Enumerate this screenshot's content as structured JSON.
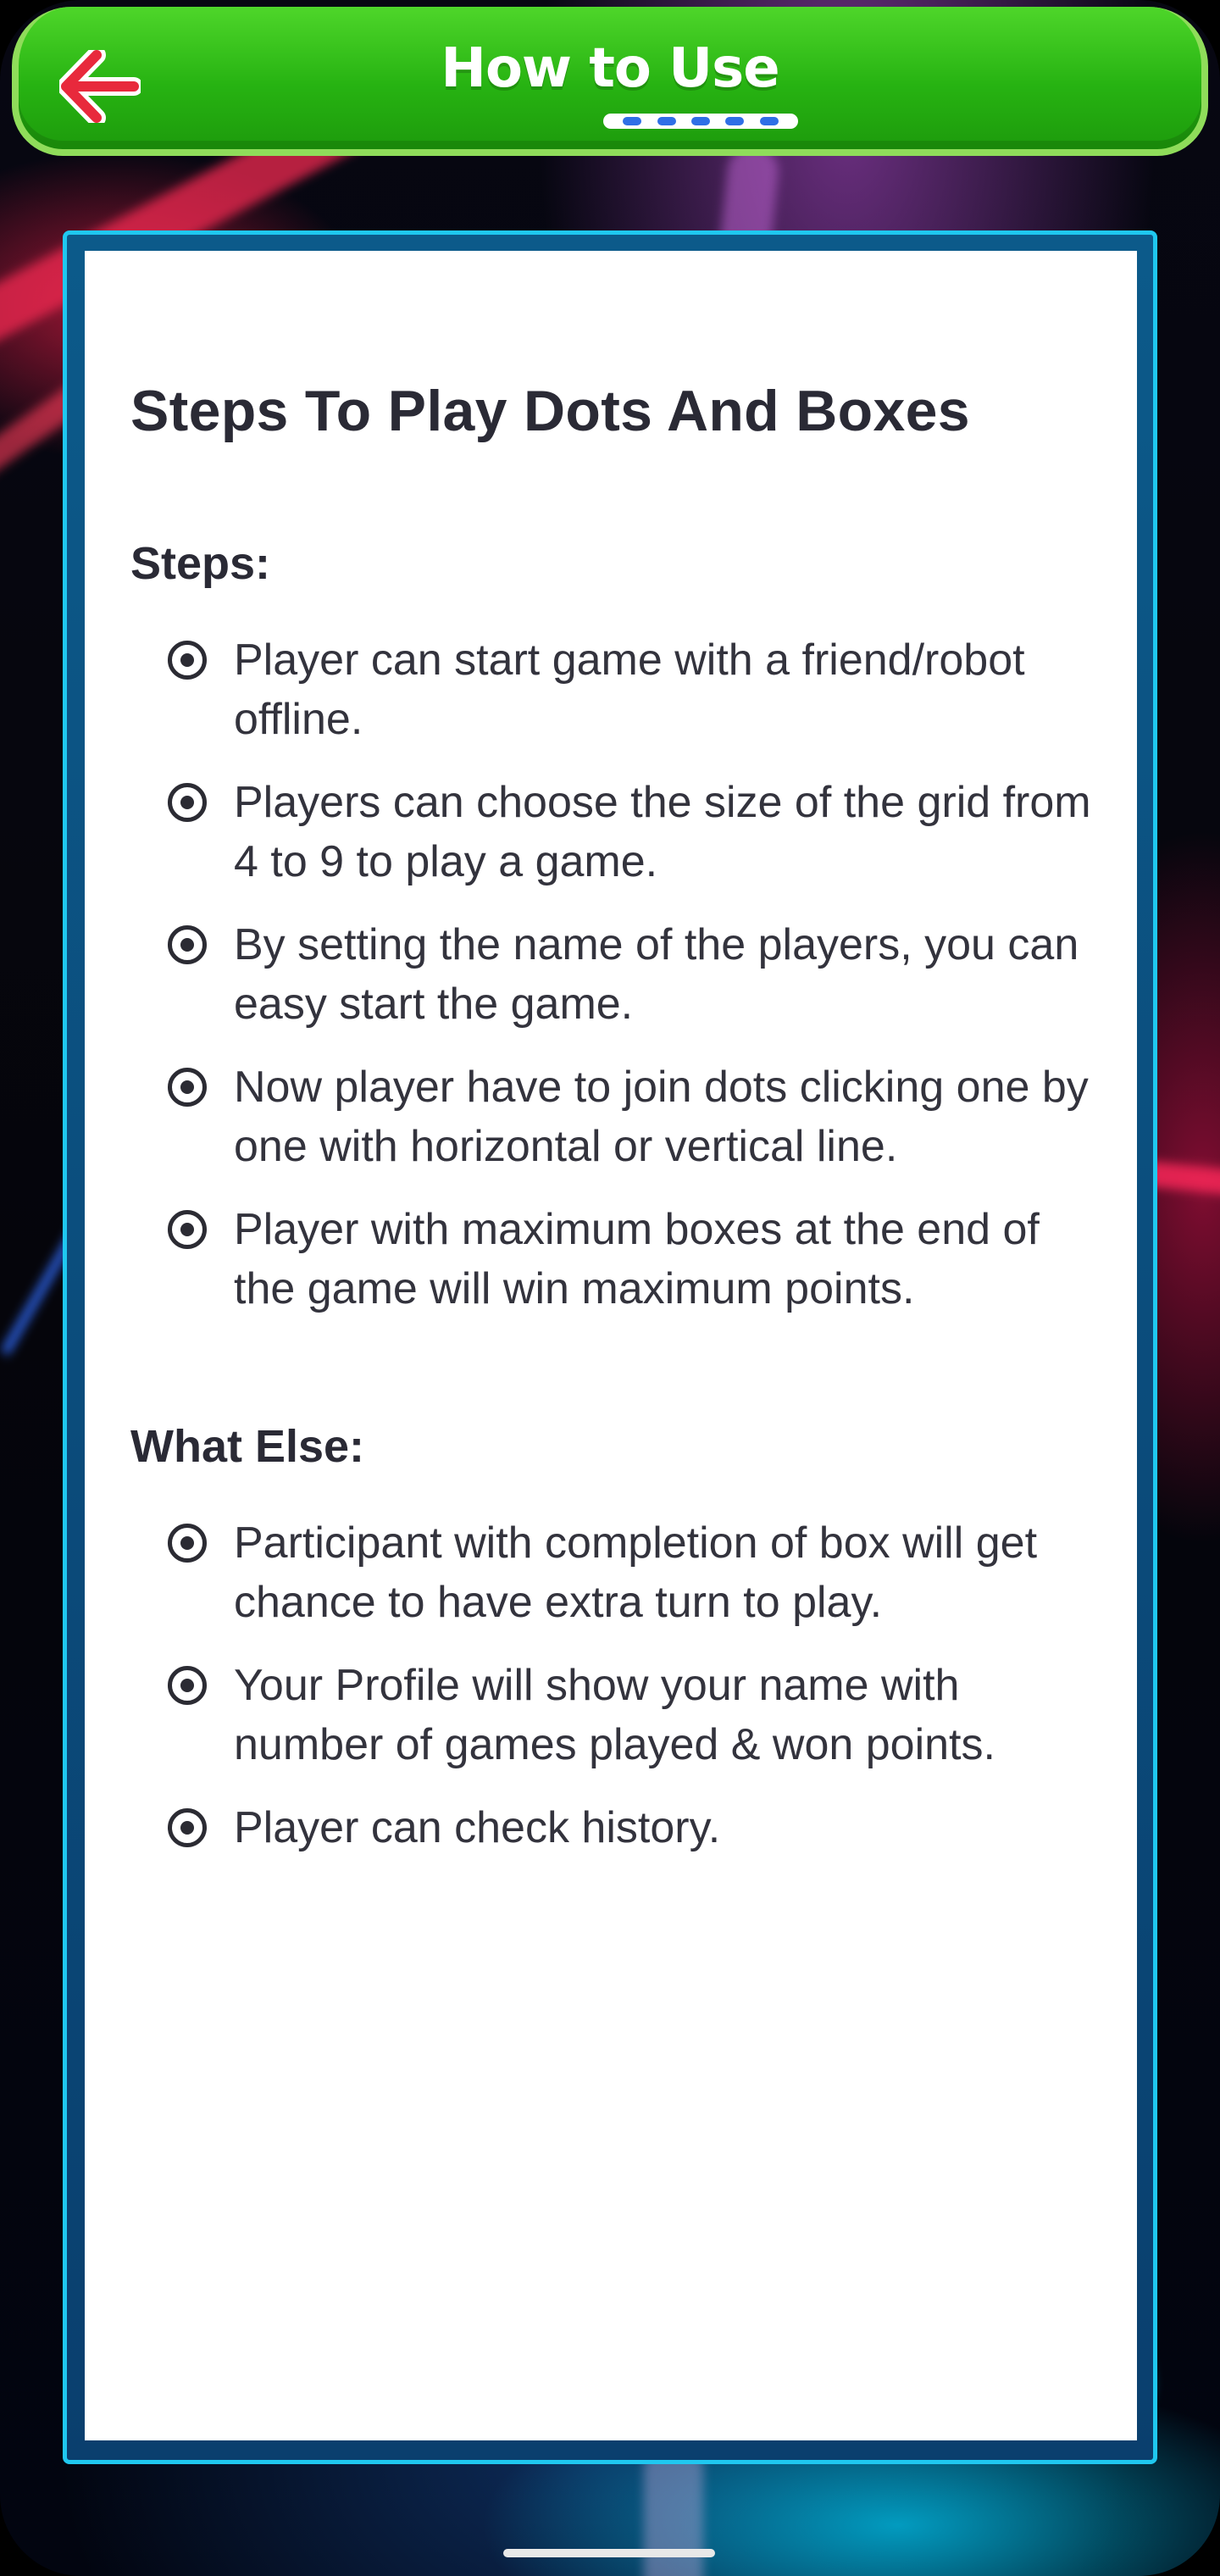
{
  "header": {
    "title": "How to Use",
    "back_icon": "arrow-left-icon",
    "colors": {
      "bar": "#27b312",
      "border": "#8fdc5a",
      "arrow": "#e8293c"
    }
  },
  "card": {
    "heading": "Steps To Play Dots And Boxes",
    "sections": [
      {
        "title": "Steps:",
        "items": [
          "Player can start game with a friend/robot offline.",
          "Players can choose the size of the grid from 4 to 9 to play a game.",
          "By setting the name of the players, you can easy start the game.",
          "Now player have to join dots clicking one by one with horizontal or vertical line.",
          "Player with maximum boxes at the end of the game will win maximum points."
        ]
      },
      {
        "title": "What Else:",
        "items": [
          "Participant with completion of box will get chance to have extra turn to play.",
          "Your Profile will show your name with number of games played & won points.",
          "Player can check history."
        ]
      }
    ],
    "bullet_icon": "radio-bullet-icon",
    "frame_color": "#1fc8f0"
  }
}
